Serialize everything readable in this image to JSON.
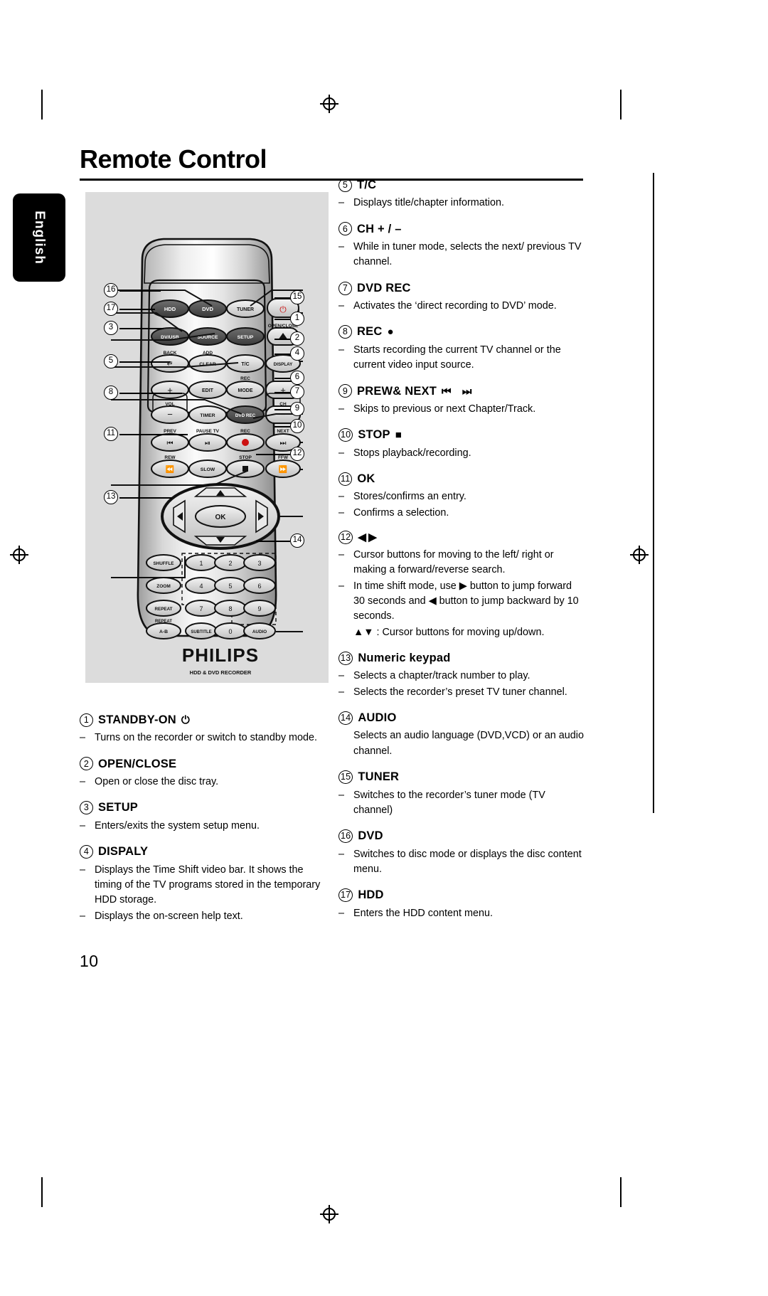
{
  "document": {
    "page_title": "Remote Control",
    "language_tab": "English",
    "page_number": "10",
    "brand": "PHILIPS",
    "brand_subtitle": "HDD & DVD RECORDER"
  },
  "figure": {
    "name": "remote-control-diagram",
    "callouts": [
      "16",
      "17",
      "3",
      "5",
      "8",
      "11",
      "13",
      "15",
      "1",
      "2",
      "4",
      "6",
      "7",
      "9",
      "10",
      "12",
      "14"
    ],
    "buttons": [
      {
        "label": "HDD",
        "dark": true
      },
      {
        "label": "DVD",
        "dark": true
      },
      {
        "label": "TUNER",
        "dark": false
      },
      {
        "label": "⏻",
        "dark": false,
        "red": true
      },
      {
        "label": "DV/USB",
        "dark": true
      },
      {
        "label": "SOURCE",
        "dark": true
      },
      {
        "label": "SETUP",
        "dark": true
      },
      {
        "label": "▲",
        "dark": false
      },
      {
        "label": "↶",
        "dark": false
      },
      {
        "label": "CLEAR",
        "dark": false
      },
      {
        "label": "T/C",
        "dark": false
      },
      {
        "label": "DISPLAY",
        "dark": false
      },
      {
        "label": "+",
        "dark": false
      },
      {
        "label": "EDIT",
        "dark": false
      },
      {
        "label": "MODE",
        "dark": false
      },
      {
        "label": "+",
        "dark": false
      },
      {
        "label": "−",
        "dark": false
      },
      {
        "label": "TIMER",
        "dark": false
      },
      {
        "label": "DVD REC",
        "dark": true
      },
      {
        "label": "−",
        "dark": false
      },
      {
        "label": "⏮",
        "dark": false
      },
      {
        "label": "▶❘❘",
        "dark": false
      },
      {
        "label": "●",
        "dark": false,
        "red": true
      },
      {
        "label": "⏭",
        "dark": false
      },
      {
        "label": "◀◀",
        "dark": false
      },
      {
        "label": "SLOW",
        "dark": false
      },
      {
        "label": "■",
        "dark": false
      },
      {
        "label": "▶▶",
        "dark": false
      },
      {
        "label": "SHUFFLE",
        "dark": false
      },
      {
        "label": "ZOOM",
        "dark": false
      },
      {
        "label": "REPEAT",
        "dark": false
      },
      {
        "label": "A-B",
        "dark": false
      },
      {
        "label": "SUBTITLE",
        "dark": false
      },
      {
        "label": "AUDIO",
        "dark": false
      }
    ],
    "button_captions": [
      "OPEN/CLOSE",
      "BACK",
      "ADD",
      "REC",
      "VOL",
      "CH",
      "PREV",
      "PAUSE TV",
      "REC",
      "NEXT",
      "REW",
      "STOP",
      "FFW",
      "REPEAT"
    ],
    "keypad": [
      "1",
      "2",
      "3",
      "4",
      "5",
      "6",
      "7",
      "8",
      "9",
      "0"
    ],
    "ok_label": "OK"
  },
  "left_column": [
    {
      "num": "1",
      "title": "STANDBY-ON",
      "glyph": "⏻",
      "bullets": [
        {
          "dash": "–",
          "text": "Turns on the recorder or switch to standby mode."
        }
      ]
    },
    {
      "num": "2",
      "title": "OPEN/CLOSE",
      "glyph": "",
      "bullets": [
        {
          "dash": "–",
          "text": "Open or close the disc tray."
        }
      ]
    },
    {
      "num": "3",
      "title": "SETUP",
      "glyph": "",
      "bullets": [
        {
          "dash": "–",
          "text": "Enters/exits the system setup menu."
        }
      ]
    },
    {
      "num": "4",
      "title": "DISPALY",
      "glyph": "",
      "bullets": [
        {
          "dash": "–",
          "text": "Displays the Time Shift video bar. It shows the timing of the TV programs stored in the temporary HDD storage."
        },
        {
          "dash": "–",
          "text": "Displays the on-screen help text."
        }
      ]
    }
  ],
  "right_column": [
    {
      "num": "5",
      "title": "T/C",
      "glyph": "",
      "bullets": [
        {
          "dash": "–",
          "text": "Displays title/chapter information."
        }
      ]
    },
    {
      "num": "6",
      "title": "CH + / –",
      "glyph": "",
      "bullets": [
        {
          "dash": "–",
          "text": "While in tuner mode, selects the next/ previous TV channel."
        }
      ]
    },
    {
      "num": "7",
      "title": "DVD REC",
      "glyph": "",
      "bullets": [
        {
          "dash": "–",
          "text": "Activates the ‘direct recording to DVD’ mode."
        }
      ]
    },
    {
      "num": "8",
      "title": "REC",
      "glyph": "●",
      "bullets": [
        {
          "dash": "–",
          "text": "Starts recording the current TV channel or the current video input source."
        }
      ]
    },
    {
      "num": "9",
      "title": "PREW& NEXT",
      "glyph": "⏮ ⏭",
      "bullets": [
        {
          "dash": "–",
          "text": "Skips to previous or next Chapter/Track."
        }
      ]
    },
    {
      "num": "10",
      "title": "STOP",
      "glyph": "■",
      "bullets": [
        {
          "dash": "–",
          "text": "Stops playback/recording."
        }
      ]
    },
    {
      "num": "11",
      "title": "OK",
      "glyph": "",
      "bullets": [
        {
          "dash": "–",
          "text": "Stores/confirms an entry."
        },
        {
          "dash": "–",
          "text": "Confirms a selection."
        }
      ]
    },
    {
      "num": "12",
      "title": "",
      "glyph": "◀ ▶",
      "bullets": [
        {
          "dash": "–",
          "text": "Cursor buttons for moving to the left/ right or making a forward/reverse search."
        },
        {
          "dash": "–",
          "text": "In time shift mode, use ▶ button to jump forward 30 seconds and ◀ button to jump backward by 10 seconds."
        },
        {
          "dash": "",
          "text": "▲▼ : Cursor buttons for moving up/down."
        }
      ]
    },
    {
      "num": "13",
      "title": "Numeric keypad",
      "glyph": "",
      "bullets": [
        {
          "dash": "–",
          "text": "Selects a chapter/track number to play."
        },
        {
          "dash": "–",
          "text": "Selects the recorder’s preset TV tuner channel."
        }
      ]
    },
    {
      "num": "14",
      "title": "AUDIO",
      "glyph": "",
      "bullets": [
        {
          "dash": "",
          "text": "Selects an audio language (DVD,VCD) or an audio channel."
        }
      ]
    },
    {
      "num": "15",
      "title": "TUNER",
      "glyph": "",
      "bullets": [
        {
          "dash": "–",
          "text": "Switches to the recorder’s tuner mode (TV channel)"
        }
      ]
    },
    {
      "num": "16",
      "title": "DVD",
      "glyph": "",
      "bullets": [
        {
          "dash": "–",
          "text": "Switches to disc mode or displays the disc content menu."
        }
      ]
    },
    {
      "num": "17",
      "title": "HDD",
      "glyph": "",
      "bullets": [
        {
          "dash": "–",
          "text": "Enters the HDD content menu."
        }
      ]
    }
  ]
}
